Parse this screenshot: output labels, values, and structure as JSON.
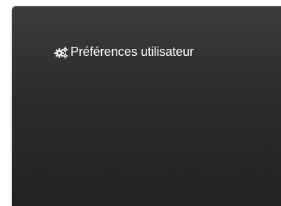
{
  "card": {
    "title": "Préférences utilisateur",
    "icon": "cogs-icon",
    "colors": {
      "background_top": "#3c3c3c",
      "background_bottom": "#222222",
      "text": "#ffffff"
    }
  }
}
